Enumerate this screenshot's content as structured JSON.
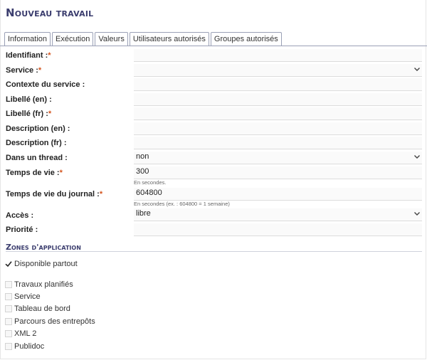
{
  "page_title": "Nouveau travail",
  "tabs": [
    {
      "label": "Information",
      "active": true
    },
    {
      "label": "Exécution"
    },
    {
      "label": "Valeurs"
    },
    {
      "label": "Utilisateurs autorisés"
    },
    {
      "label": "Groupes autorisés"
    }
  ],
  "form": {
    "identifiant": {
      "label": "Identifiant :",
      "value": ""
    },
    "service": {
      "label": "Service :",
      "value": ""
    },
    "contexte": {
      "label": "Contexte du service :",
      "value": ""
    },
    "libelle_en": {
      "label": "Libellé (en) :",
      "value": ""
    },
    "libelle_fr": {
      "label": "Libellé (fr) :",
      "value": ""
    },
    "description_en": {
      "label": "Description (en) :",
      "value": ""
    },
    "description_fr": {
      "label": "Description (fr) :",
      "value": ""
    },
    "thread": {
      "label": "Dans un thread :",
      "value": "non"
    },
    "temps_vie": {
      "label": "Temps de vie :",
      "value": "300",
      "help": "En secondes."
    },
    "temps_vie_journal": {
      "label": "Temps de vie du journal :",
      "value": "604800",
      "help": "En secondes (ex. : 604800 = 1 semaine)"
    },
    "acces": {
      "label": "Accès :",
      "value": "libre"
    },
    "priorite": {
      "label": "Priorité :",
      "value": ""
    }
  },
  "required_marker": "*",
  "zones": {
    "title": "Zones d'application",
    "anywhere": {
      "label": "Disponible partout",
      "checked": true
    },
    "items": [
      {
        "label": "Travaux planifiés",
        "checked": false
      },
      {
        "label": "Service",
        "checked": false
      },
      {
        "label": "Tableau de bord",
        "checked": false
      },
      {
        "label": "Parcours des entrepôts",
        "checked": false
      },
      {
        "label": "XML 2",
        "checked": false
      },
      {
        "label": "Publidoc",
        "checked": false
      }
    ]
  },
  "colors": {
    "title": "#3b3d6e",
    "required": "#d4551f",
    "tab_border": "#9aa0b6"
  }
}
